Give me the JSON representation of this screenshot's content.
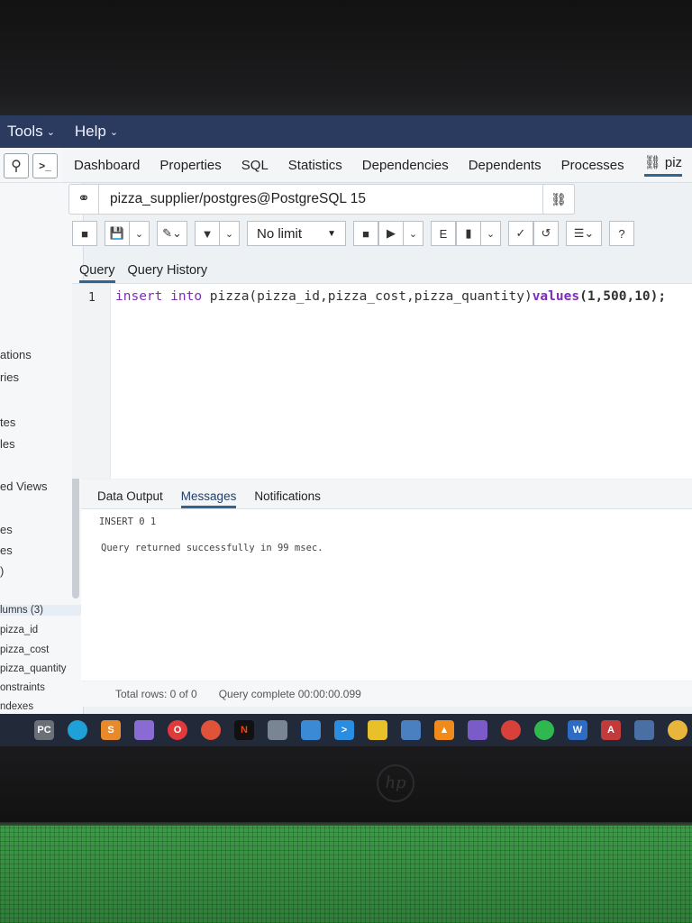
{
  "menubar": {
    "items": [
      {
        "label": "Tools"
      },
      {
        "label": "Help"
      }
    ]
  },
  "tree": {
    "items": [
      "ations",
      "ries",
      "tes",
      "les",
      "ed Views",
      "es",
      "es",
      ")",
      "lumns (3)",
      "pizza_id",
      "pizza_cost",
      "pizza_quantity",
      "onstraints",
      "ndexes"
    ]
  },
  "tabs": [
    "Dashboard",
    "Properties",
    "SQL",
    "Statistics",
    "Dependencies",
    "Dependents",
    "Processes",
    "piz"
  ],
  "connection": {
    "label": "pizza_supplier/postgres@PostgreSQL 15"
  },
  "toolbar": {
    "limit_label": "No limit"
  },
  "query_tabs": [
    "Query",
    "Query History"
  ],
  "editor": {
    "line_number": "1",
    "kw_insert": "insert",
    "kw_into": "into",
    "table_part": " pizza(pizza_id,pizza_cost,pizza_quantity)",
    "kw_values": "values",
    "values_part": "(1,500,10);"
  },
  "result_tabs": [
    "Data Output",
    "Messages",
    "Notifications"
  ],
  "messages": {
    "line1": "INSERT 0 1",
    "line2": "Query returned successfully in 99 msec."
  },
  "status": {
    "total_rows": "Total rows: 0 of 0",
    "query_complete": "Query complete 00:00:00.099"
  },
  "taskbar": {
    "icons": [
      "pc-icon",
      "edge-icon",
      "sublime-icon",
      "app-icon",
      "opera-icon",
      "chrome-icon",
      "netflix-icon",
      "files-icon",
      "store-icon",
      "vscode-icon",
      "notes-icon",
      "explorer-icon",
      "vlc-icon",
      "visual-studio-icon",
      "chrome2-icon",
      "whatsapp-icon",
      "word-icon",
      "access-icon",
      "pgadmin-icon",
      "misc-icon"
    ]
  },
  "laptop": {
    "brand": "hp"
  },
  "colors": {
    "menubar": "#2b3a5f",
    "accent": "#326690",
    "keyword": "#7b2fb8"
  }
}
